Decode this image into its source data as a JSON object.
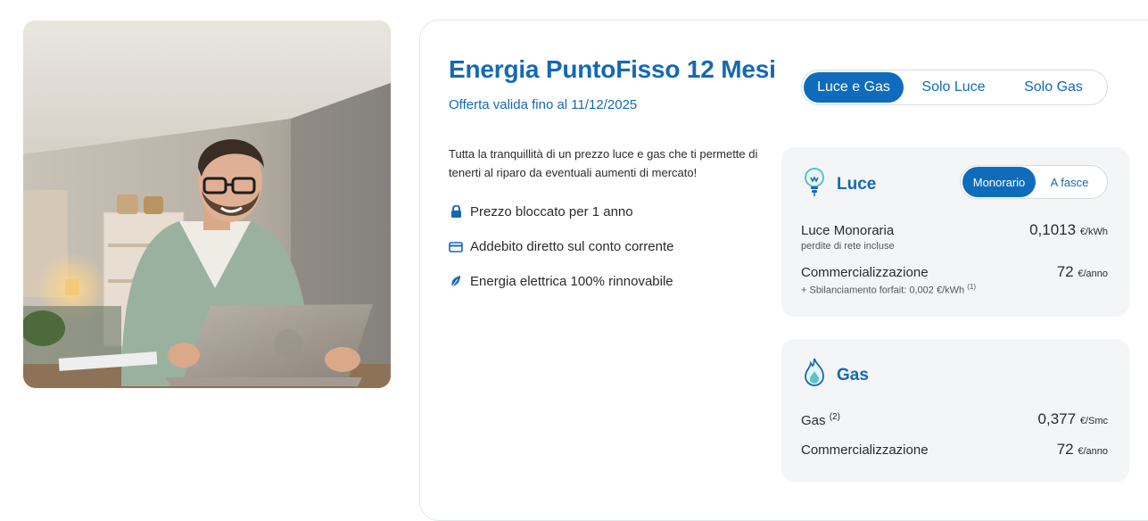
{
  "offer": {
    "title": "Energia PuntoFisso 12 Mesi",
    "validity": "Offerta valida fino al 11/12/2025",
    "description": "Tutta la tranquillità di un prezzo luce e gas che ti permette di tenerti al riparo da eventuali aumenti di mercato!",
    "features": [
      {
        "icon": "lock-icon",
        "label": "Prezzo bloccato per 1 anno"
      },
      {
        "icon": "card-icon",
        "label": "Addebito diretto sul conto corrente"
      },
      {
        "icon": "leaf-icon",
        "label": "Energia elettrica 100% rinnovabile"
      }
    ]
  },
  "supply_tabs": {
    "options": [
      "Luce e Gas",
      "Solo Luce",
      "Solo Gas"
    ],
    "selected": "Luce e Gas"
  },
  "luce": {
    "icon": "lightbulb-icon",
    "title": "Luce",
    "tariff_tabs": {
      "options": [
        "Monorario",
        "A fasce"
      ],
      "selected": "Monorario"
    },
    "rows": [
      {
        "name": "Luce Monoraria",
        "note": "perdite di rete incluse",
        "value": "0,1013",
        "unit": "€/kWh"
      },
      {
        "name": "Commercializzazione",
        "note": "+ Sbilanciamento forfait: 0,002 €/kWh",
        "note_ref": "(1)",
        "value": "72",
        "unit": "€/anno"
      }
    ]
  },
  "gas": {
    "icon": "flame-icon",
    "title": "Gas",
    "rows": [
      {
        "name": "Gas",
        "name_ref": "(2)",
        "value": "0,377",
        "unit": "€/Smc"
      },
      {
        "name": "Commercializzazione",
        "value": "72",
        "unit": "€/anno"
      }
    ]
  },
  "colors": {
    "primary": "#1469b4",
    "active_tab": "#0f6cbd",
    "box_bg": "#f3f5f7",
    "accent_icon": "#5bc3c9"
  }
}
